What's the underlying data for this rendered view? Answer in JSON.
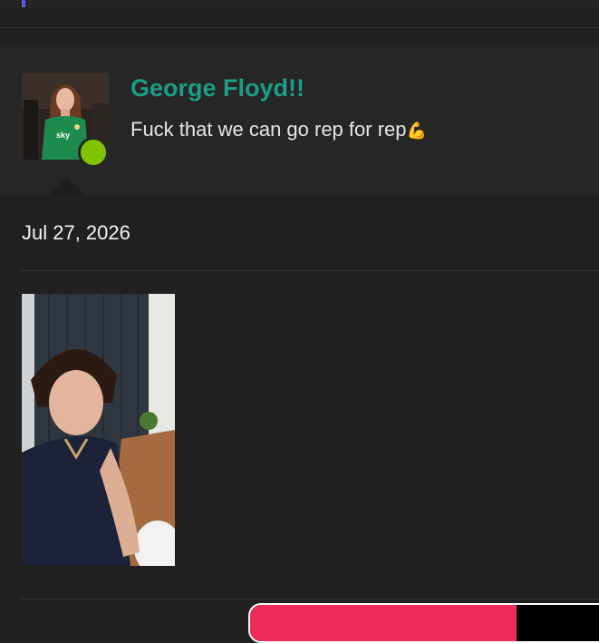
{
  "post": {
    "username": "George Floyd!!",
    "message": "Fuck that we can go rep for rep",
    "emoji": "💪",
    "online": true,
    "online_color": "#7fc400",
    "username_color": "#1a9e86"
  },
  "date": "Jul 27, 2026",
  "icons": {
    "online_status": "online-status-dot",
    "flexed_biceps": "flexed-biceps-emoji"
  },
  "bottom_bar": {
    "progress": 0.73,
    "accent": "#ee2c5a"
  }
}
